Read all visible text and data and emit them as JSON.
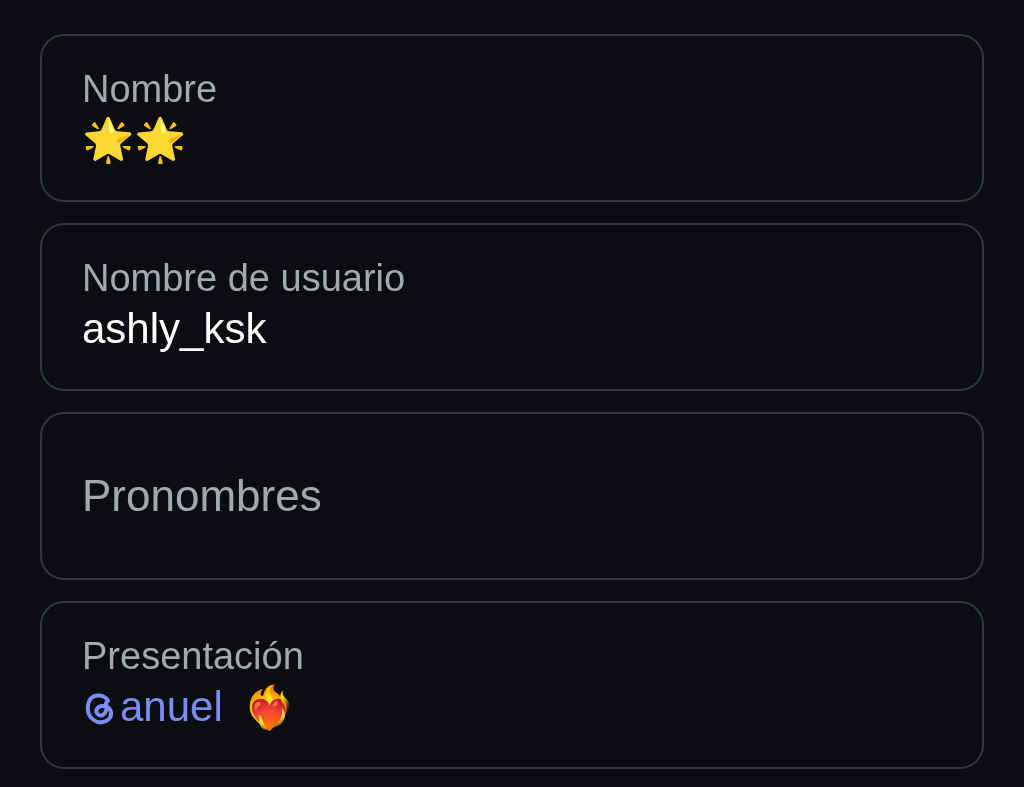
{
  "fields": [
    {
      "kind": "text",
      "label": "Nombre",
      "value": "🌟🌟"
    },
    {
      "kind": "text",
      "label": "Nombre de usuario",
      "value": "ashly_ksk"
    },
    {
      "kind": "placeholder",
      "placeholder": "Pronombres"
    },
    {
      "kind": "bio",
      "label": "Presentación",
      "mention": "anuel",
      "emoji": "❤️‍🔥"
    }
  ]
}
